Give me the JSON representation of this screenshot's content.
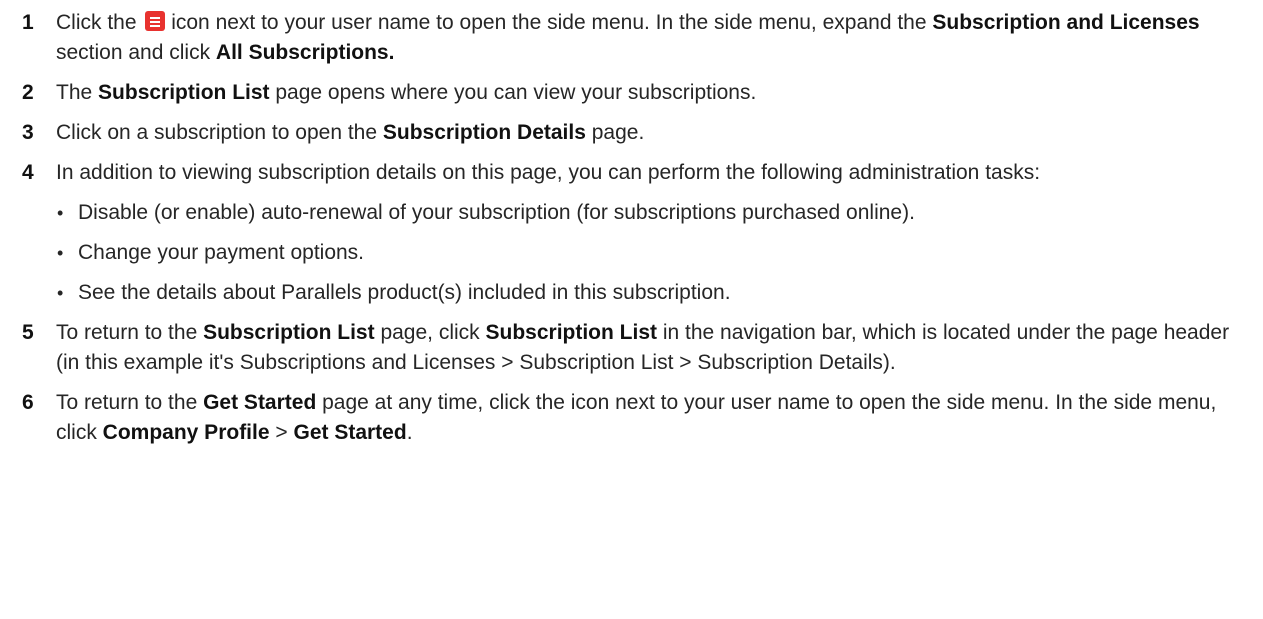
{
  "steps": [
    {
      "num": "1",
      "t1": "Click the",
      "t2": " icon next to your user name to open the side menu. In the side menu, expand the ",
      "b1": "Subscription and Licenses",
      "t3": " section and click ",
      "b2": "All Subscriptions."
    },
    {
      "num": "2",
      "t1": "The ",
      "b1": "Subscription List",
      "t2": " page opens where you can view your subscriptions."
    },
    {
      "num": "3",
      "t1": "Click on a subscription to open the ",
      "b1": "Subscription Details",
      "t2": " page."
    },
    {
      "num": "4",
      "t1": "In addition to viewing subscription details on this page, you can perform the following administration tasks:",
      "bullets": [
        "Disable (or enable) auto-renewal of your subscription (for subscriptions purchased online).",
        "Change your payment options.",
        "See the details about Parallels product(s) included in this subscription."
      ]
    },
    {
      "num": "5",
      "t1": "To return to the ",
      "b1": "Subscription List",
      "t2": " page, click ",
      "b2": "Subscription List",
      "t3": " in the navigation bar, which is located under the page header (in this example it's Subscriptions and Licenses > Subscription List > Subscription Details)."
    },
    {
      "num": "6",
      "t1": "To return to the ",
      "b1": "Get Started",
      "t2": " page at any time, click the  icon next to your user name to open the side menu. In the side menu, click ",
      "b2": "Company Profile",
      "t3": " > ",
      "b3": "Get Started",
      "t4": "."
    }
  ],
  "icons": {
    "menu_icon_color": "#e8322f",
    "menu_icon_name": "menu-icon"
  }
}
